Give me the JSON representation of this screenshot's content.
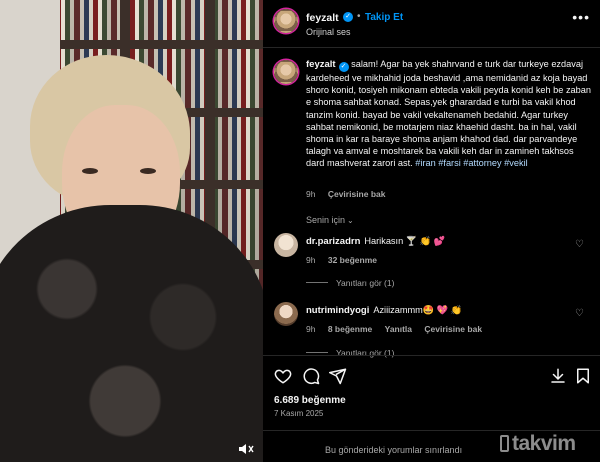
{
  "header": {
    "username": "feyzalt",
    "follow_label": "Takip Et",
    "subtitle": "Orijinal ses",
    "dot": "•"
  },
  "caption": {
    "username": "feyzalt",
    "text": "salam! Agar ba yek shahrvand e turk dar turkeye ezdavaj kardeheed ve mikhahid joda beshavid ,ama nemidanid az koja bayad shoro konid, tosiyeh mikonam ebteda vakili peyda konid keh be zaban e shoma sahbat konad. Sepas,yek gharardad e turbi ba vakil khod tanzim konid. bayad be vakil vekaltenameh bedahid. Agar turkey sahbat nemikonid, be motarjem niaz khaehid dasht. ba in hal, vakil shoma in kar ra baraye shoma anjam khahod dad. dar parvandeye talagh va amval e moshtarek ba vakili keh dar in zamineh takhsos dard mashverat zarori ast.",
    "hashtags": "#iran #farsi #attorney #vekil",
    "age": "9h",
    "translate_label": "Çevirisine bak"
  },
  "section_label": "Senin için",
  "comments": [
    {
      "username": "dr.parizadrn",
      "text": "Harikasın 🍸 👏 💕",
      "age": "9h",
      "likes": "32 beğenme",
      "replies_label": "Yanıtları gör (1)"
    },
    {
      "username": "nutrimindyogi",
      "text": "Aziiizammm🤩 💖 👏",
      "age": "9h",
      "likes": "8 beğenme",
      "reply_label": "Yanıtla",
      "translate_label": "Çevirisine bak",
      "replies_label": "Yanıtları gör (1)"
    }
  ],
  "likes_count": "6.689 beğenme",
  "date": "7 Kasım 2025",
  "footer_text": "Bu gönderideki yorumlar sınırlandı",
  "watermark": "takvim",
  "icons": {
    "more": "more-icon",
    "verified": "verified-badge-icon",
    "heart": "heart-icon",
    "comment": "comment-icon",
    "share": "share-icon",
    "download": "download-icon",
    "save": "bookmark-icon",
    "volume": "volume-muted-icon"
  },
  "colors": {
    "accent": "#0095f6",
    "background": "#000000",
    "muted": "#a8a8a8"
  }
}
